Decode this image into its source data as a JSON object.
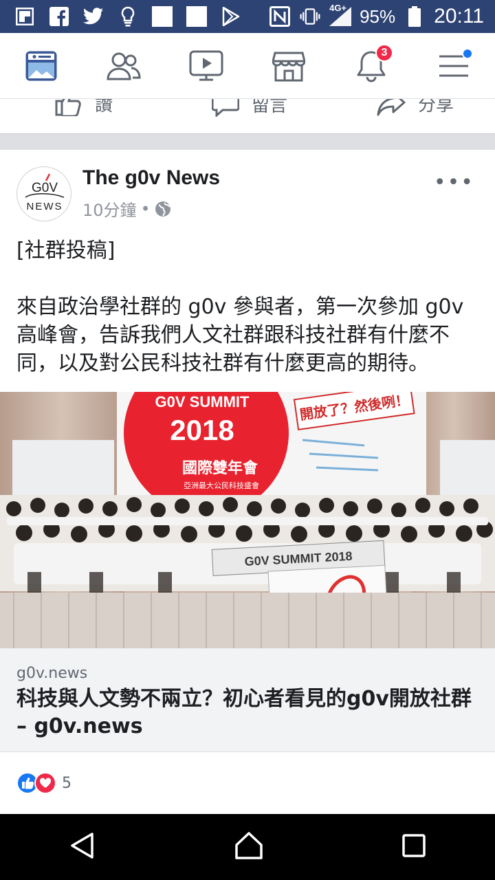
{
  "status_bar": {
    "network": "4G+",
    "battery": "95%",
    "time": "20:11"
  },
  "navbar": {
    "notifications_badge": "3"
  },
  "prev_post_actions": {
    "like": "讚",
    "comment": "留言",
    "share": "分享"
  },
  "post": {
    "page_name": "The g0v News",
    "time": "10分鐘",
    "avatar_top": "G0V",
    "avatar_bottom": "NEWS",
    "text": [
      "[社群投稿]",
      "",
      "來自政治學社群的 g0v 參與者，第一次參加 g0v",
      "高峰會，告訴我們人文社群跟科技社群有什麼不",
      "同，以及對公民科技社群有什麼更高的期待。"
    ],
    "photo": {
      "banner_title": "G0V SUMMIT",
      "banner_year": "2018",
      "banner_subtitle": "國際雙年會",
      "banner_tagline": "亞洲最大公民科技盛會",
      "speech_bubble": "開放了？然後咧！",
      "sign_text": "G0V SUMMIT 2018"
    },
    "link": {
      "domain": "g0v.news",
      "title": "科技與人文勢不兩立？初心者看見的g0v開放社群 – g0v.news"
    },
    "reaction_count": "5"
  },
  "colors": {
    "fb_blue": "#3b5998",
    "status_bar": "#2d4373",
    "like_blue": "#1877f2",
    "love_red": "#f0284a"
  }
}
